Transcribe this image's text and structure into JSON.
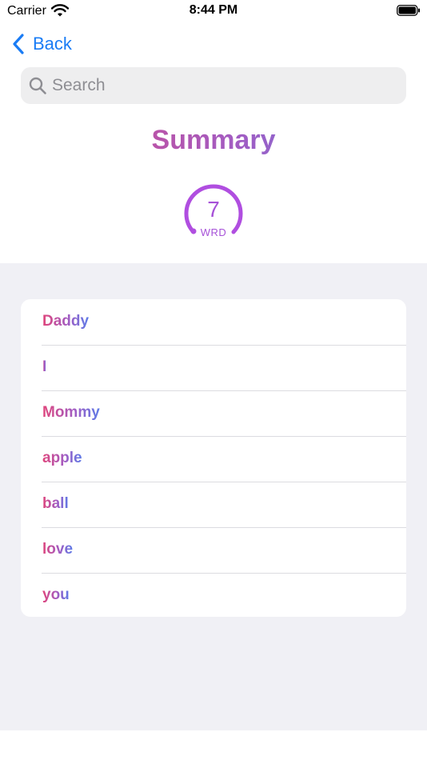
{
  "status_bar": {
    "carrier": "Carrier",
    "time": "8:44 PM"
  },
  "nav": {
    "back_label": "Back",
    "back_icon": "chevron-left-icon"
  },
  "search": {
    "placeholder": "Search",
    "value": "",
    "icon": "magnifying-glass-icon"
  },
  "summary": {
    "title": "Summary",
    "gauge_value": "7",
    "gauge_unit": "WRD"
  },
  "words": [
    "Daddy",
    "I",
    "Mommy",
    "apple",
    "ball",
    "love",
    "you"
  ],
  "colors": {
    "accent_blue": "#1a7cf5",
    "gradient_start": "#e0457b",
    "gradient_end": "#5c7be8",
    "gauge_purple": "#a752d8",
    "list_background": "#f0f0f5"
  }
}
